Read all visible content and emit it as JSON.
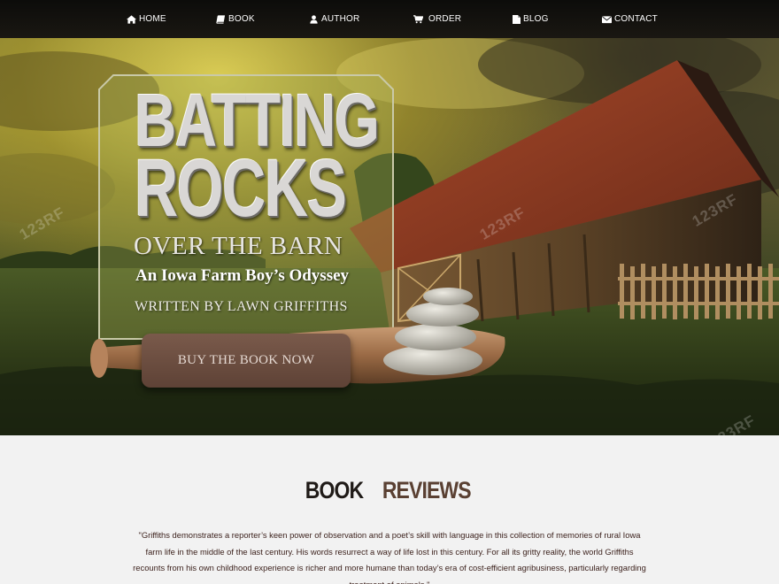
{
  "nav": {
    "items": [
      {
        "label": "HOME",
        "icon": "home-icon"
      },
      {
        "label": "BOOK",
        "icon": "book-icon"
      },
      {
        "label": "AUTHOR",
        "icon": "user-icon"
      },
      {
        "label": "ORDER",
        "icon": "cart-icon"
      },
      {
        "label": "BLOG",
        "icon": "file-icon"
      },
      {
        "label": "CONTACT",
        "icon": "envelope-icon"
      }
    ]
  },
  "hero": {
    "title_line1": "BATTING",
    "title_line2": "ROCKS",
    "subtitle": "OVER THE BARN",
    "tagline": "An Iowa Farm Boy’s Odyssey",
    "byline": "WRITTEN BY LAWN GRIFFITHS",
    "buy_button": "BUY THE BOOK NOW",
    "watermark": "123RF"
  },
  "reviews": {
    "title_part1": "BOOK",
    "title_part2": "REVIEWS",
    "quote": "\"Griffiths demonstrates a reporter’s keen power of observation and a poet’s skill with language in this collection of memories of rural Iowa farm life in the middle of the last century. His words resurrect a way of life lost in this century. For all its gritty reality, the world Griffiths recounts from his own childhood experience is richer and more humane than today’s era of cost-efficient agribusiness, particularly regarding treatment of animals.\""
  },
  "colors": {
    "nav_bg": "#0c0c0a",
    "accent_brown": "#5a4032",
    "button_bg": "#6b4d40",
    "reviews_bg": "#f2f2f2",
    "review_text": "#3a1f1a"
  }
}
